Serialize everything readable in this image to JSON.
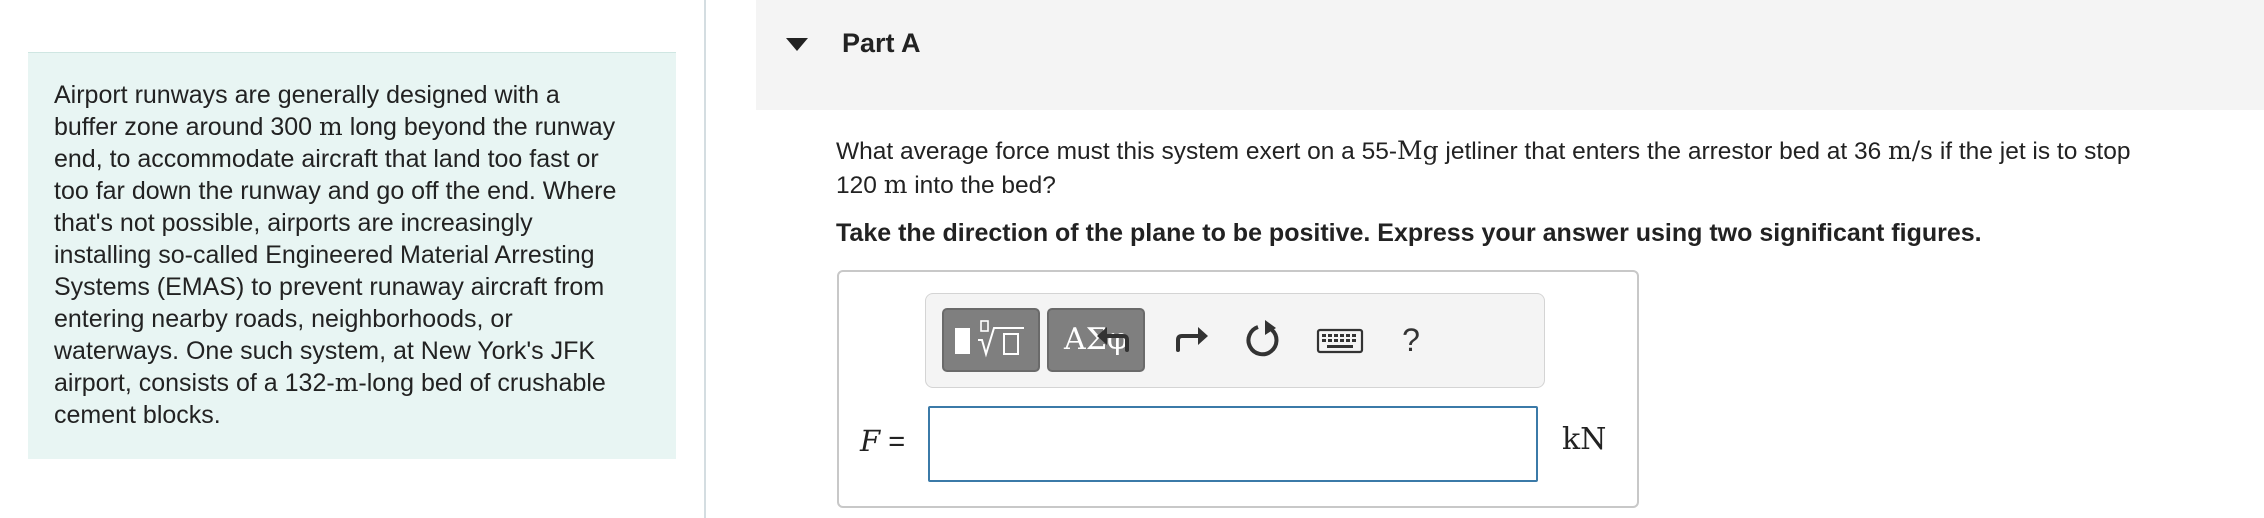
{
  "intro": {
    "lines": [
      [
        "Airport runways are generally designed with a"
      ],
      [
        "buffer zone around 300 ",
        {
          "math": "m"
        },
        " long beyond the runway"
      ],
      [
        "end, to accommodate aircraft that land too fast or"
      ],
      [
        "too far down the runway and go off the end. Where"
      ],
      [
        "that's not possible, airports are increasingly"
      ],
      [
        "installing so-called Engineered Material Arresting"
      ],
      [
        "Systems (EMAS) to prevent runaway aircraft from"
      ],
      [
        "entering nearby roads, neighborhoods, or"
      ],
      [
        "waterways. One such system, at New York's JFK"
      ],
      [
        "airport, consists of a 132-",
        {
          "math": "m"
        },
        "-long bed of crushable"
      ],
      [
        "cement blocks."
      ]
    ]
  },
  "part": {
    "title": "Part A",
    "toggle_icon": "caret-down-icon"
  },
  "question": {
    "lines": [
      [
        "What average force must this system exert on a 55-",
        {
          "math": "Mg"
        },
        " jetliner that enters the arrestor bed at 36 ",
        {
          "math": "m/s"
        },
        " if the jet is to stop"
      ],
      [
        "120 ",
        {
          "math": "m"
        },
        " into the bed?"
      ]
    ]
  },
  "instructions": "Take the direction of the plane to be positive. Express your answer using two significant figures.",
  "toolbar": {
    "greek_label": "ΑΣφ",
    "help_label": "?",
    "buttons": [
      "templates-icon",
      "greek-letters",
      "undo-icon",
      "redo-icon",
      "reset-icon",
      "keyboard-icon",
      "help-icon"
    ]
  },
  "answer": {
    "variable": "F",
    "equals": "=",
    "value": "",
    "unit": "kN"
  },
  "colors": {
    "intro_bg": "#e8f5f3",
    "header_bg": "#f4f4f4",
    "input_border": "#3b7aa8",
    "toolbar_btn": "#7f7f7f"
  }
}
